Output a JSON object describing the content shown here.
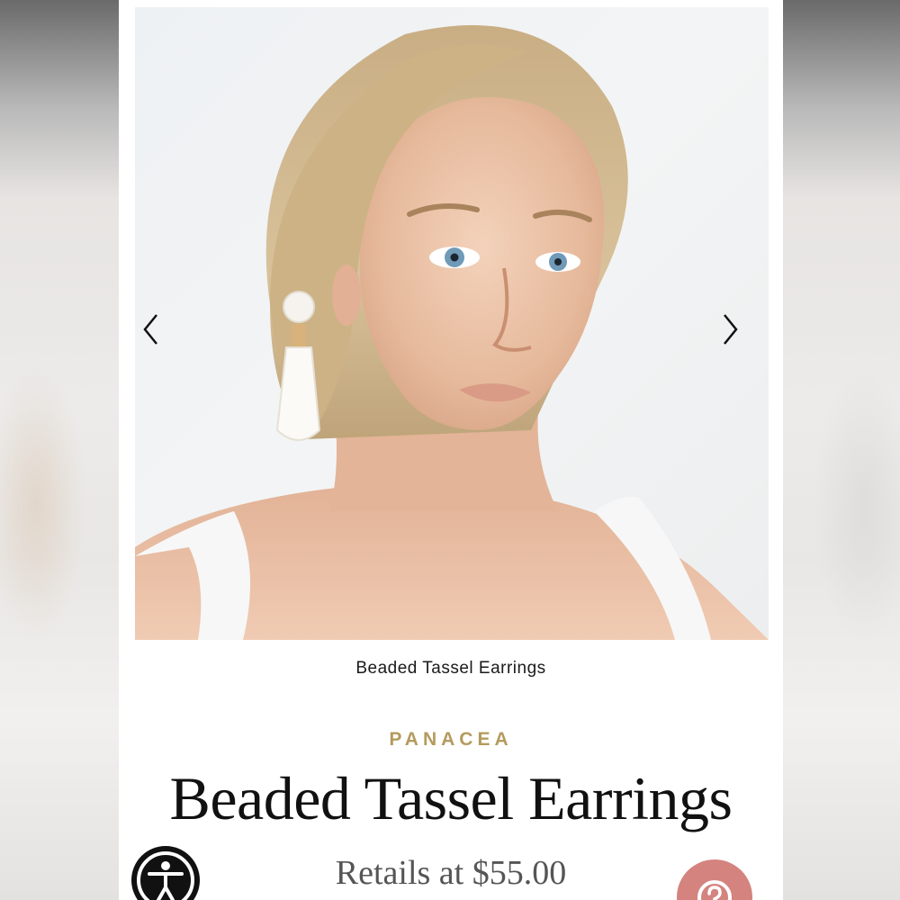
{
  "product": {
    "caption": "Beaded Tassel Earrings",
    "brand": "PANACEA",
    "title": "Beaded Tassel Earrings",
    "price": "Retails at $55.00"
  },
  "icons": {
    "prev": "chevron-left-icon",
    "next": "chevron-right-icon",
    "accessibility": "accessibility-icon",
    "help": "question-mark-icon"
  },
  "colors": {
    "brand": "#b49b5e",
    "help_button": "#d4837f",
    "accessibility_button": "#111111"
  }
}
